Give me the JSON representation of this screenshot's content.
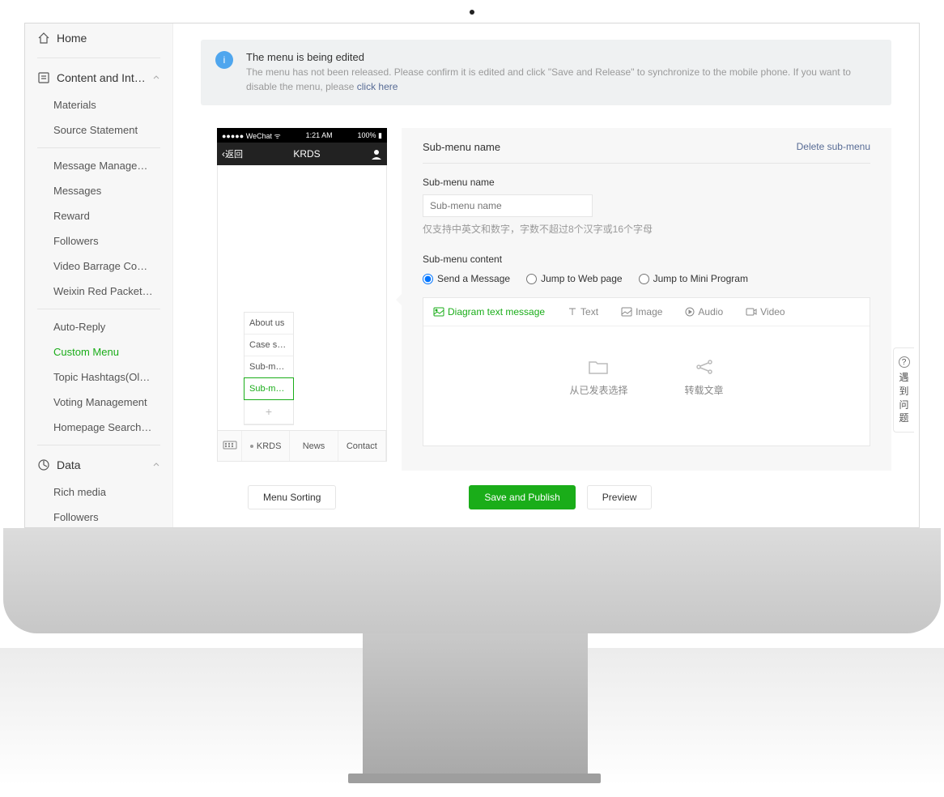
{
  "sidebar": {
    "home": "Home",
    "contentInteraction": "Content and Int…",
    "group1": [
      "Materials",
      "Source Statement"
    ],
    "group2": [
      "Message Manage…",
      "Messages",
      "Reward",
      "Followers",
      "Video Barrage Co…",
      "Weixin Red Packet…"
    ],
    "group3": [
      "Auto-Reply",
      "Custom Menu",
      "Topic Hashtags(Ol…",
      "Voting Management",
      "Homepage Search…"
    ],
    "data": "Data",
    "group4": [
      "Rich media",
      "Followers"
    ]
  },
  "alert": {
    "title": "The menu is being edited",
    "desc1": "The menu has not been released. Please confirm it is edited and click \"Save and Release\" to synchronize to the mobile phone. If you want to disable the menu, please ",
    "link": "click here"
  },
  "phone": {
    "carrier": "WeChat",
    "time": "1:21 AM",
    "battery": "100%",
    "back": "返回",
    "title": "KRDS",
    "subitems": [
      "About us",
      "Case stu…",
      "Sub-me…",
      "Sub-me…"
    ],
    "menu": [
      "KRDS",
      "News",
      "Contact"
    ]
  },
  "panel": {
    "title": "Sub-menu name",
    "deleteLabel": "Delete sub-menu",
    "nameLabel": "Sub-menu name",
    "placeholder": "Sub-menu name",
    "nameHint": "仅支持中英文和数字，字数不超过8个汉字或16个字母",
    "contentLabel": "Sub-menu content",
    "radios": {
      "msg": "Send a Message",
      "web": "Jump to Web page",
      "mini": "Jump to Mini Program"
    },
    "tabs": {
      "diagram": "Diagram text message",
      "text": "Text",
      "image": "Image",
      "audio": "Audio",
      "video": "Video"
    },
    "pickers": {
      "select": "从已发表选择",
      "share": "转载文章"
    }
  },
  "buttons": {
    "sort": "Menu Sorting",
    "save": "Save and Publish",
    "preview": "Preview"
  },
  "feedback": "遇到问题"
}
